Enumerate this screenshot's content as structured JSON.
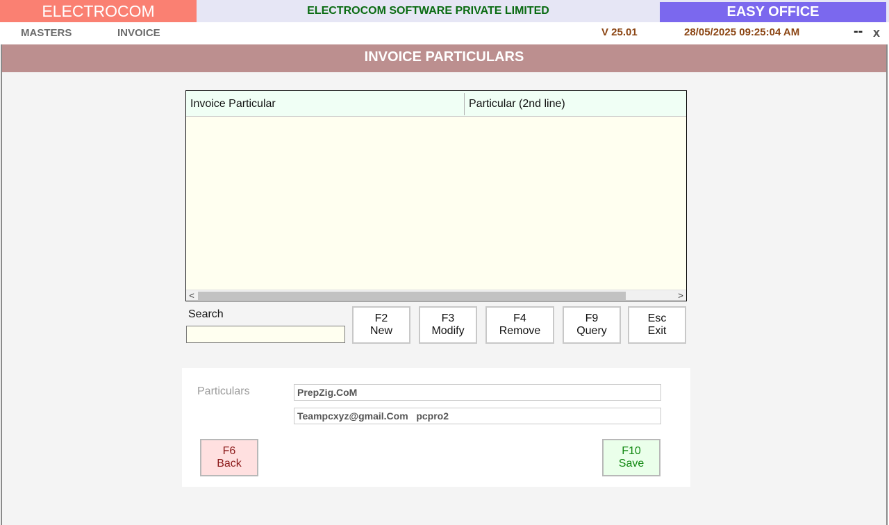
{
  "app": {
    "brand_left": "ELECTROCOM",
    "company": "ELECTROCOM SOFTWARE PRIVATE LIMITED",
    "brand_right": "EASY OFFICE"
  },
  "menu": {
    "items": [
      "MASTERS",
      "INVOICE"
    ],
    "version": "V 25.01",
    "datetime": "28/05/2025 09:25:04 AM",
    "minimize": "--",
    "close": "x"
  },
  "page": {
    "title": "INVOICE PARTICULARS"
  },
  "grid": {
    "columns": [
      "Invoice Particular",
      "Particular (2nd line)"
    ],
    "rows": [],
    "scroll_left": "<",
    "scroll_right": ">"
  },
  "search": {
    "label": "Search",
    "value": ""
  },
  "actions": [
    {
      "key": "F2",
      "label": "New"
    },
    {
      "key": "F3",
      "label": "Modify"
    },
    {
      "key": "F4",
      "label": "Remove"
    },
    {
      "key": "F9",
      "label": "Query"
    },
    {
      "key": "Esc",
      "label": "Exit"
    }
  ],
  "form": {
    "particulars_label": "Particulars",
    "line1": "PrepZig.CoM",
    "line2": "Teampcxyz@gmail.Com   pcpro2",
    "back": {
      "key": "F6",
      "label": "Back"
    },
    "save": {
      "key": "F10",
      "label": "Save"
    }
  },
  "colors": {
    "brand_left_bg": "#fa8072",
    "brand_right_bg": "#7b68ee",
    "company_text": "#0a6b12",
    "header_bg": "#bc8f8f",
    "grid_bg": "#fffff0",
    "back_bg": "#ffe0e0",
    "save_bg": "#eaffea"
  }
}
